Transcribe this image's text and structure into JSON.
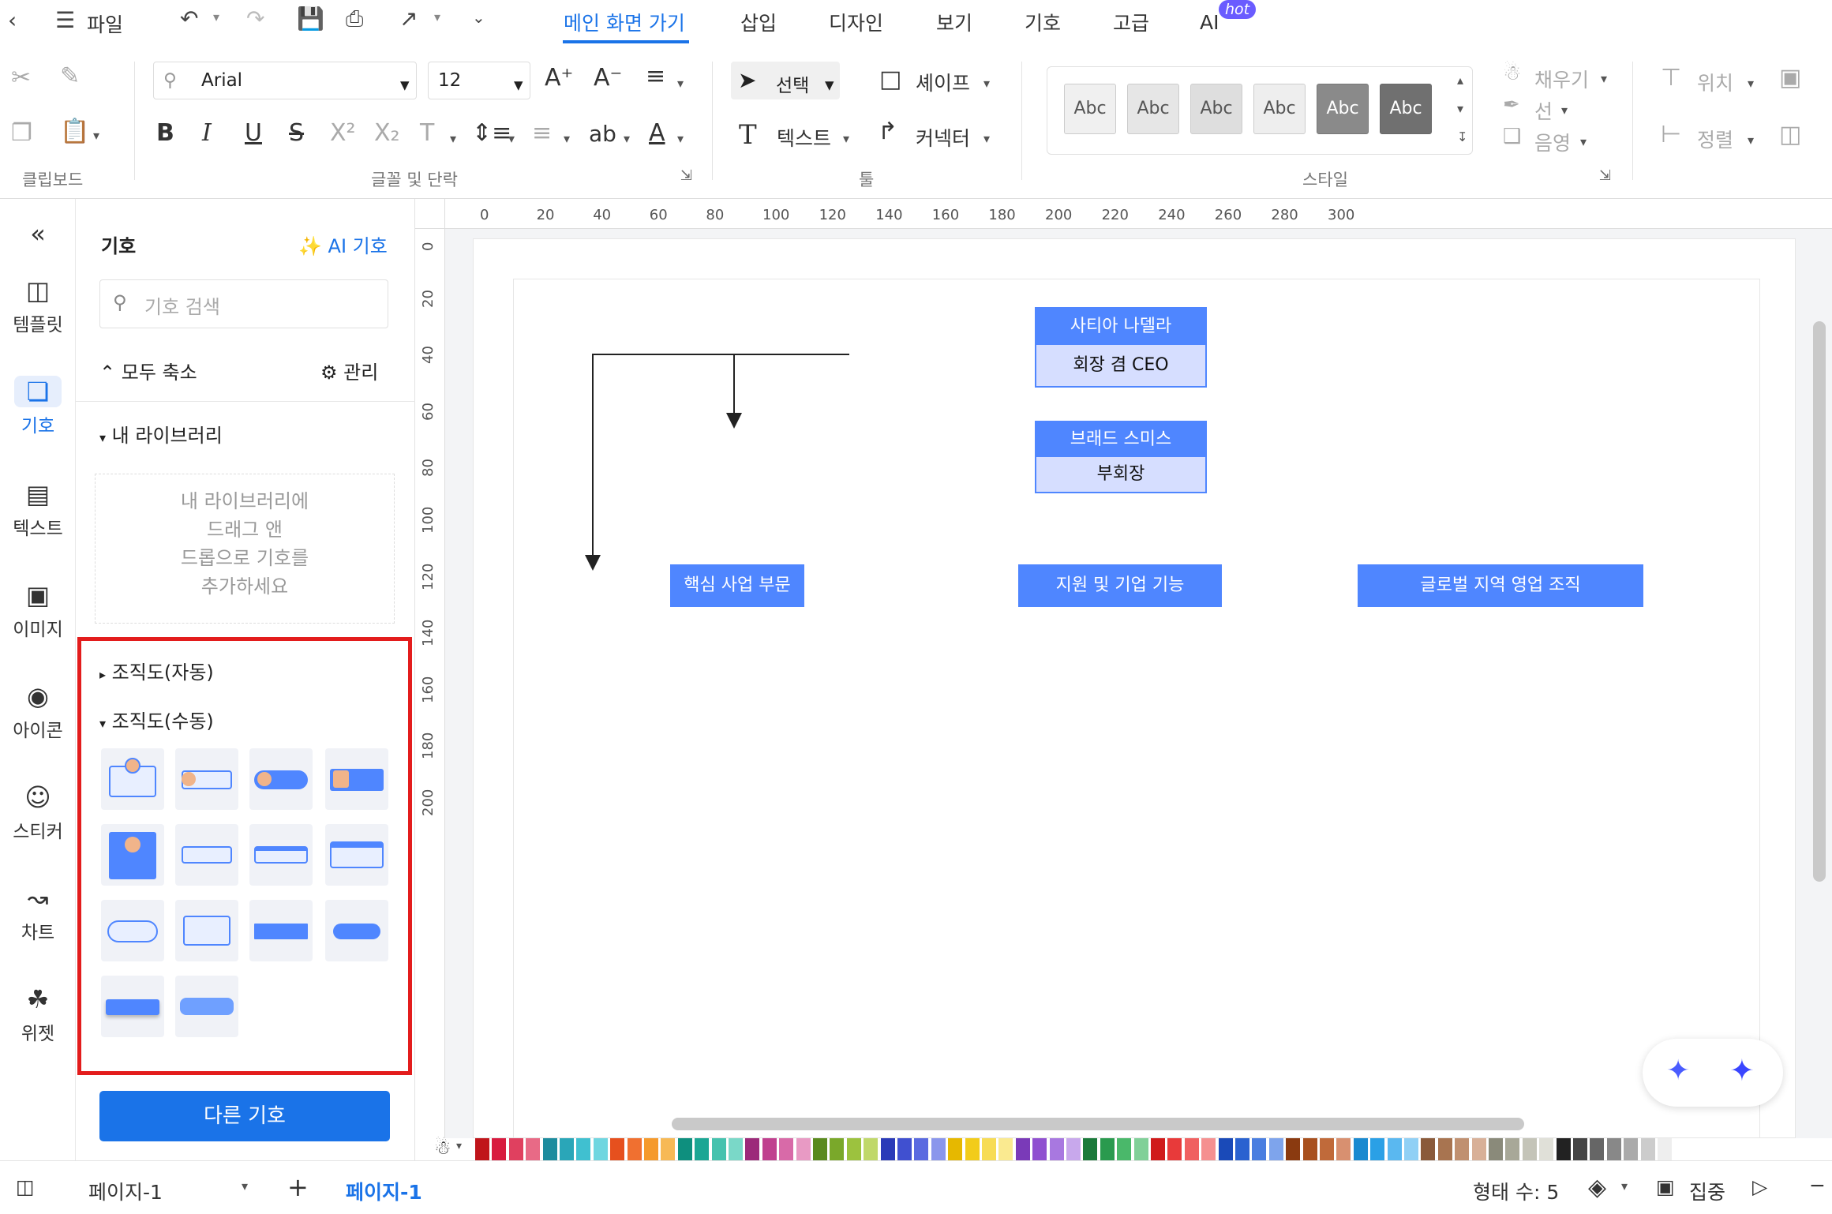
{
  "menu": {
    "file": "파일",
    "tabs": [
      "메인 화면 가기",
      "삽입",
      "디자인",
      "보기",
      "기호",
      "고급",
      "AI"
    ],
    "hot_badge": "hot"
  },
  "ribbon": {
    "font_name": "Arial",
    "font_size": "12",
    "select": "선택",
    "shape": "셰이프",
    "text": "텍스트",
    "connector": "커넥터",
    "style_samples": [
      "Abc",
      "Abc",
      "Abc",
      "Abc",
      "Abc",
      "Abc"
    ],
    "fill": "채우기",
    "line": "선",
    "shadow": "음영",
    "position": "위치",
    "align": "정렬",
    "ab": "ab",
    "groups": {
      "clipboard": "클립보드",
      "font": "글꼴 및 단락",
      "tools": "툴",
      "style": "스타일"
    }
  },
  "rail": [
    "템플릿",
    "기호",
    "텍스트",
    "이미지",
    "아이콘",
    "스티커",
    "차트",
    "위젯"
  ],
  "panel": {
    "title": "기호",
    "ai_symbol": "AI 기호",
    "search_placeholder": "기호 검색",
    "collapse_all": "모두 축소",
    "manage": "관리",
    "my_library": "내 라이브러리",
    "my_library_hint": [
      "내 라이브러리에",
      "드래그 앤",
      "드롭으로 기호를",
      "추가하세요"
    ],
    "org_auto": "조직도(자동)",
    "org_manual": "조직도(수동)",
    "more_symbols": "다른 기호"
  },
  "ruler": {
    "h": [
      "0",
      "20",
      "40",
      "60",
      "80",
      "100",
      "120",
      "140",
      "160",
      "180",
      "200",
      "220",
      "240",
      "260",
      "280",
      "300"
    ],
    "v": [
      "0",
      "20",
      "40",
      "60",
      "80",
      "100",
      "120",
      "140",
      "160",
      "180",
      "200"
    ]
  },
  "diagram": {
    "ceo_name": "사티아 나델라",
    "ceo_title": "회장 겸 CEO",
    "vc_name": "브래드 스미스",
    "vc_title": "부회장",
    "dept1": "핵심 사업 부문",
    "dept2": "지원 및 기업 기능",
    "dept3": "글로벌 지역 영업 조직"
  },
  "colors": {
    "accent": "#1a73e8",
    "node": "#4f86ff",
    "node_body": "#d6deff",
    "highlight": "#e31c1c",
    "palette": [
      "#c0151b",
      "#d81b3f",
      "#e0405f",
      "#e86a86",
      "#1d8c9e",
      "#2aa6b8",
      "#40c0d0",
      "#6fd6e0",
      "#e6501e",
      "#f07030",
      "#f59a2c",
      "#f7b955",
      "#0e8f7e",
      "#1ba694",
      "#45c2ae",
      "#7ad8c8",
      "#9c2a7a",
      "#c0408f",
      "#d86aa8",
      "#e89ac4",
      "#5a8a1e",
      "#7aa82a",
      "#9cc23e",
      "#c0d86a",
      "#2a3ab8",
      "#4050d0",
      "#5a6ae0",
      "#8a96ec",
      "#e6b800",
      "#f2cc1a",
      "#f7dc55",
      "#faea90",
      "#7a3ab8",
      "#9050d0",
      "#a878e0",
      "#c8a8ec",
      "#1a7a3a",
      "#2a9a4e",
      "#4ab86a",
      "#80d098",
      "#d01a1a",
      "#e83a3a",
      "#f06060",
      "#f59090",
      "#1a4ab8",
      "#2a62d0",
      "#4a7ee0",
      "#7ea4ec",
      "#8a3a10",
      "#a8501e",
      "#c06a3a",
      "#d89070",
      "#1a8ad0",
      "#2aa0e6",
      "#5ab8f0",
      "#90d0f5",
      "#8a5a3a",
      "#a87450",
      "#c09070",
      "#d8b098",
      "#8a8a7a",
      "#a8a898",
      "#c4c4b8",
      "#e0e0d8",
      "#222222",
      "#444444",
      "#666666",
      "#888888",
      "#aaaaaa",
      "#cccccc",
      "#eeeeee"
    ]
  },
  "status": {
    "page_select": "페이지-1",
    "page_tab": "페이지-1",
    "shape_count": "형태 수: 5",
    "focus": "집중"
  }
}
